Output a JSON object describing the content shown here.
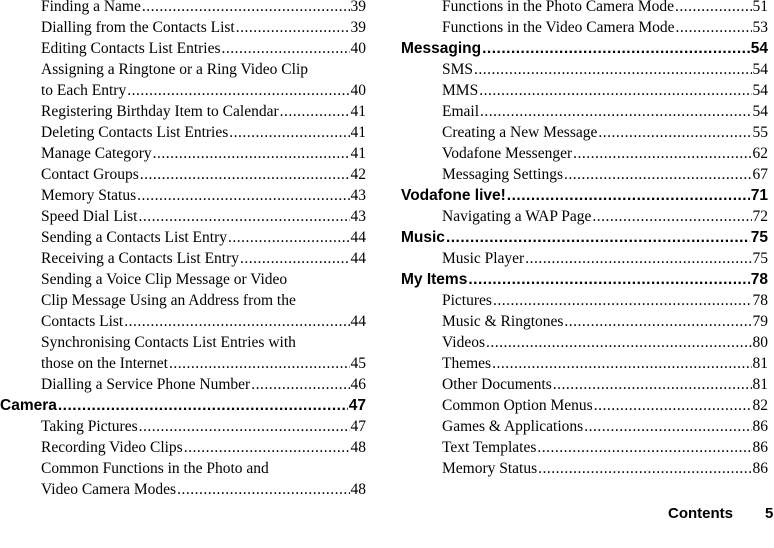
{
  "left": [
    {
      "type": "entry",
      "lines": [
        "Finding a Name"
      ],
      "page": "39"
    },
    {
      "type": "entry",
      "lines": [
        "Dialling from the Contacts List "
      ],
      "page": "39"
    },
    {
      "type": "entry",
      "lines": [
        "Editing Contacts List Entries "
      ],
      "page": "40"
    },
    {
      "type": "entry",
      "lines": [
        "Assigning a Ringtone or a Ring Video Clip",
        "to Each Entry "
      ],
      "page": "40"
    },
    {
      "type": "entry",
      "lines": [
        "Registering Birthday Item to Calendar "
      ],
      "page": "41"
    },
    {
      "type": "entry",
      "lines": [
        "Deleting Contacts List Entries "
      ],
      "page": "41"
    },
    {
      "type": "entry",
      "lines": [
        "Manage Category "
      ],
      "page": "41"
    },
    {
      "type": "entry",
      "lines": [
        "Contact Groups "
      ],
      "page": "42"
    },
    {
      "type": "entry",
      "lines": [
        "Memory Status "
      ],
      "page": "43"
    },
    {
      "type": "entry",
      "lines": [
        "Speed Dial List "
      ],
      "page": "43"
    },
    {
      "type": "entry",
      "lines": [
        "Sending a Contacts List Entry "
      ],
      "page": "44"
    },
    {
      "type": "entry",
      "lines": [
        "Receiving a Contacts List Entry "
      ],
      "page": "44"
    },
    {
      "type": "entry",
      "lines": [
        "Sending a Voice Clip Message or Video",
        "Clip Message Using an Address from the",
        "Contacts List "
      ],
      "page": "44"
    },
    {
      "type": "entry",
      "lines": [
        "Synchronising Contacts List Entries with",
        "those on the Internet "
      ],
      "page": "45"
    },
    {
      "type": "entry",
      "lines": [
        "Dialling a Service Phone Number "
      ],
      "page": "46"
    },
    {
      "type": "head",
      "lines": [
        "Camera "
      ],
      "page": "47"
    },
    {
      "type": "entry",
      "lines": [
        "Taking Pictures "
      ],
      "page": "47"
    },
    {
      "type": "entry",
      "lines": [
        "Recording Video Clips "
      ],
      "page": "48"
    },
    {
      "type": "entry",
      "lines": [
        "Common Functions in the Photo and",
        "Video Camera Modes "
      ],
      "page": "48"
    }
  ],
  "right": [
    {
      "type": "entry",
      "lines": [
        "Functions in the Photo Camera Mode "
      ],
      "page": "51"
    },
    {
      "type": "entry",
      "lines": [
        "Functions in the Video Camera Mode "
      ],
      "page": "53"
    },
    {
      "type": "head",
      "lines": [
        "Messaging "
      ],
      "page": "54"
    },
    {
      "type": "entry",
      "lines": [
        "SMS "
      ],
      "page": "54"
    },
    {
      "type": "entry",
      "lines": [
        "MMS "
      ],
      "page": "54"
    },
    {
      "type": "entry",
      "lines": [
        "Email "
      ],
      "page": "54"
    },
    {
      "type": "entry",
      "lines": [
        "Creating a New Message "
      ],
      "page": "55"
    },
    {
      "type": "entry",
      "lines": [
        "Vodafone Messenger "
      ],
      "page": "62"
    },
    {
      "type": "entry",
      "lines": [
        "Messaging Settings "
      ],
      "page": "67"
    },
    {
      "type": "head",
      "lines": [
        "Vodafone live! "
      ],
      "page": "71"
    },
    {
      "type": "entry",
      "lines": [
        "Navigating a WAP Page "
      ],
      "page": "72"
    },
    {
      "type": "head",
      "lines": [
        "Music "
      ],
      "page": "75"
    },
    {
      "type": "entry",
      "lines": [
        "Music Player "
      ],
      "page": "75"
    },
    {
      "type": "head",
      "lines": [
        "My Items "
      ],
      "page": "78"
    },
    {
      "type": "entry",
      "lines": [
        "Pictures "
      ],
      "page": "78"
    },
    {
      "type": "entry",
      "lines": [
        "Music & Ringtones "
      ],
      "page": "79"
    },
    {
      "type": "entry",
      "lines": [
        "Videos "
      ],
      "page": "80"
    },
    {
      "type": "entry",
      "lines": [
        "Themes "
      ],
      "page": "81"
    },
    {
      "type": "entry",
      "lines": [
        "Other Documents "
      ],
      "page": "81"
    },
    {
      "type": "entry",
      "lines": [
        "Common Option Menus "
      ],
      "page": "82"
    },
    {
      "type": "entry",
      "lines": [
        "Games & Applications "
      ],
      "page": "86"
    },
    {
      "type": "entry",
      "lines": [
        "Text Templates "
      ],
      "page": "86"
    },
    {
      "type": "entry",
      "lines": [
        "Memory Status "
      ],
      "page": "86"
    }
  ],
  "footer": {
    "section": "Contents",
    "page_number": "5"
  }
}
